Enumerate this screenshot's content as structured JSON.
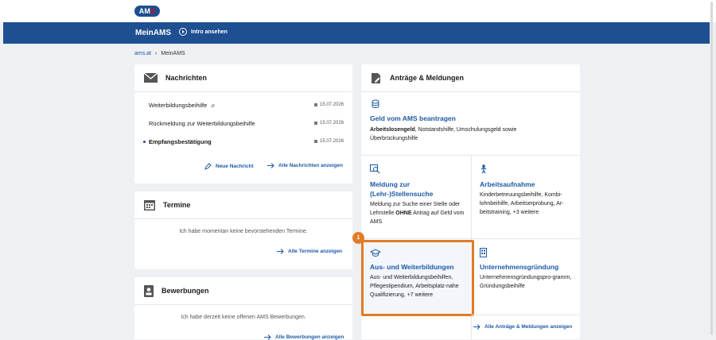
{
  "logo": {
    "text": "AM",
    "accent": "S"
  },
  "nav": {
    "title": "MeinAMS",
    "intro": "Intro ansehen"
  },
  "breadcrumb": {
    "home": "ams.at",
    "current": "MeinAMS"
  },
  "messages": {
    "title": "Nachrichten",
    "items": [
      {
        "subject": "Weiterbildungsbeihilfe",
        "date": "15.07.2026",
        "attachment": true,
        "unread": false
      },
      {
        "subject": "Rückmeldung zur Weiterbildungsbeihilfe",
        "date": "15.07.2026",
        "attachment": false,
        "unread": false
      },
      {
        "subject": "Empfangsbestätigung",
        "date": "15.07.2026",
        "attachment": false,
        "unread": true
      }
    ],
    "new_message": "Neue Nachricht",
    "show_all": "Alle Nachrichten anzeigen"
  },
  "appointments": {
    "title": "Termine",
    "empty": "Ich habe momentan keine bevorstehenden Termine.",
    "show_all": "Alle Termine anzeigen"
  },
  "applications": {
    "title": "Bewerbungen",
    "empty": "Ich habe derzeit keine offenen AMS Bewerbungen.",
    "show_all": "Alle Bewerbungen anzeigen"
  },
  "requests": {
    "title": "Anträge & Meldungen",
    "money": {
      "title": "Geld vom AMS beantragen",
      "text_bold": "Arbeitslosengeld",
      "text_rest": ", Notstandshilfe, Umschulungsgeld sowie Überbrückungshilfe"
    },
    "job_search": {
      "title_line1": "Meldung zur",
      "title_line2": "(Lehr-)Stellensuche",
      "text_1": "Meldung zur Suche einer Stelle oder Lehrstelle ",
      "text_bold": "OHNE",
      "text_2": " Antrag auf Geld vom AMS"
    },
    "employment": {
      "title": "Arbeitsaufnahme",
      "text": "Kinderbetreuungsbeihilfe, Kombi-lohnbeihilfe, Arbeitserprobung, Ar-beitstraining, +3 weitere"
    },
    "training": {
      "title": "Aus- und Weiterbildungen",
      "text": "Aus- und Weiterbildungsbeihilfen, Pflegestipendium, Arbeitsplatz-nahe Qualifizierung, +7 weitere"
    },
    "founding": {
      "title": "Unternehmensgründung",
      "text": "Unternehmensgründungspro-gramm, Gründungsbeihilfe"
    },
    "show_all": "Alle Anträge & Meldungen anzeigen"
  },
  "step_badge": "1",
  "colors": {
    "brand": "#1d4f91",
    "link": "#1d5aa6",
    "highlight": "#e07b26"
  }
}
